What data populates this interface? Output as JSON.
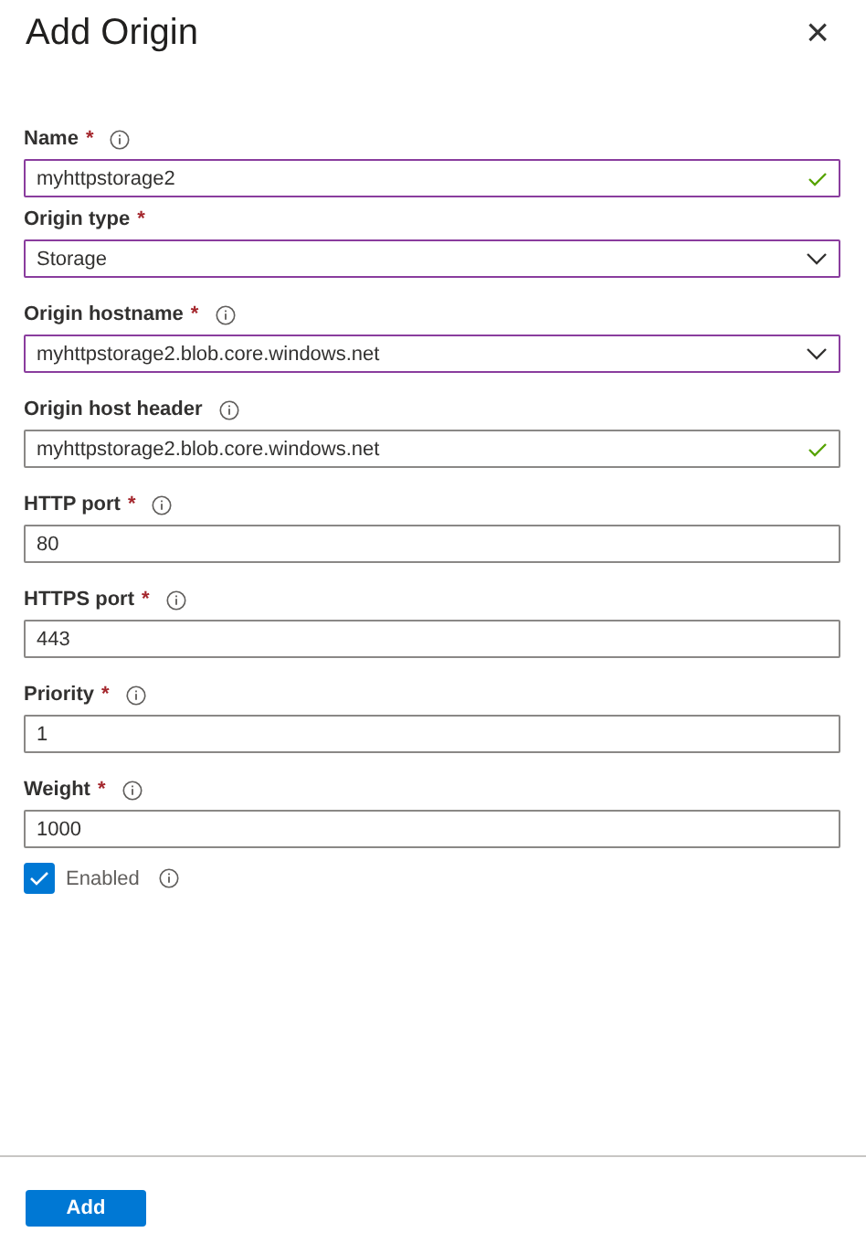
{
  "panel": {
    "title": "Add Origin",
    "close": "×"
  },
  "fields": [
    {
      "label": "Name",
      "required": true,
      "info": true,
      "kind": "text",
      "value": "myhttpstorage2",
      "highlighted": true,
      "valid": true
    },
    {
      "label": "Origin type",
      "required": true,
      "info": false,
      "kind": "select",
      "value": "Storage",
      "highlighted": true,
      "valid": false
    },
    {
      "label": "Origin hostname",
      "required": true,
      "info": true,
      "kind": "select",
      "value": "myhttpstorage2.blob.core.windows.net",
      "highlighted": true,
      "valid": false
    },
    {
      "label": "Origin host header",
      "required": false,
      "info": true,
      "kind": "text",
      "value": "myhttpstorage2.blob.core.windows.net",
      "highlighted": false,
      "valid": true
    },
    {
      "label": "HTTP port",
      "required": true,
      "info": true,
      "kind": "text",
      "value": "80",
      "highlighted": false,
      "valid": false
    },
    {
      "label": "HTTPS port",
      "required": true,
      "info": true,
      "kind": "text",
      "value": "443",
      "highlighted": false,
      "valid": false
    },
    {
      "label": "Priority",
      "required": true,
      "info": true,
      "kind": "text",
      "value": "1",
      "highlighted": false,
      "valid": false
    },
    {
      "label": "Weight",
      "required": true,
      "info": true,
      "kind": "text",
      "value": "1000",
      "highlighted": false,
      "valid": false
    }
  ],
  "enabled": {
    "label": "Enabled",
    "checked": true,
    "info": true
  },
  "required_mark": "*",
  "footer": {
    "button": "Add"
  }
}
